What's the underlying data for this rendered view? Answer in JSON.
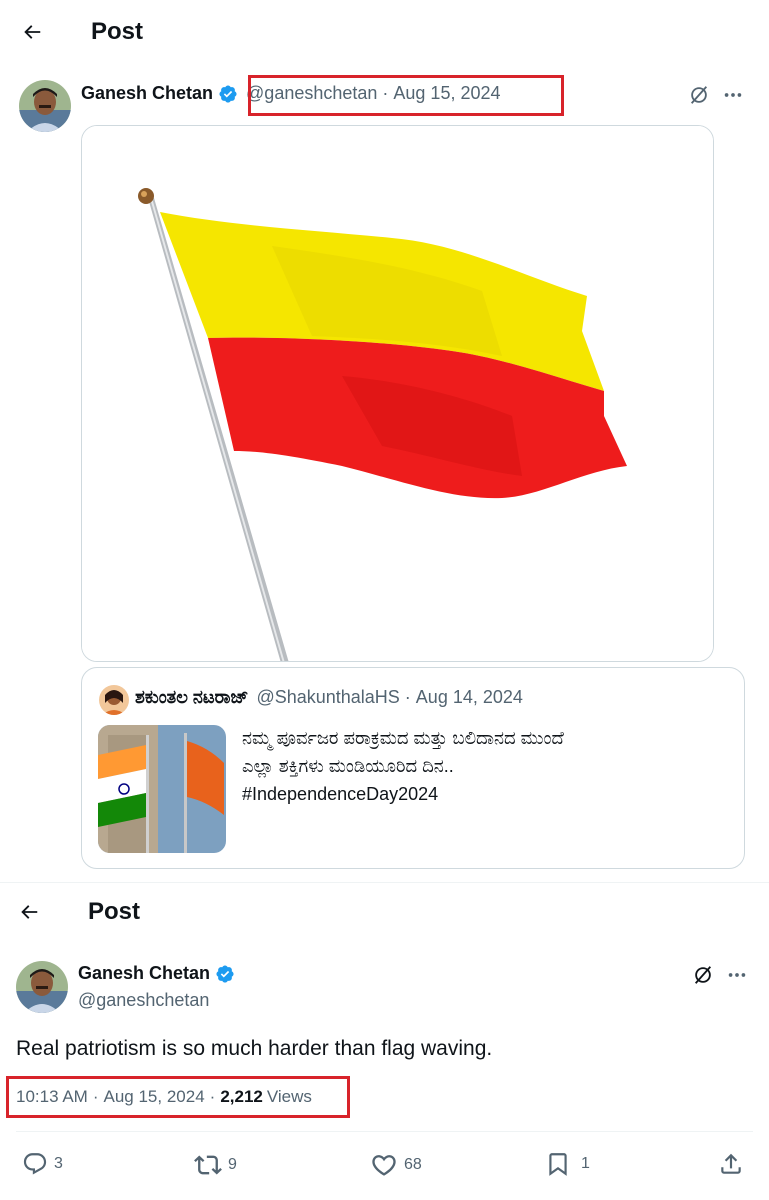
{
  "header": {
    "title": "Post"
  },
  "post1": {
    "author_name": "Ganesh Chetan",
    "handle": "@ganeshchetan",
    "date": "Aug 15, 2024",
    "separator": "·",
    "flag_colors": {
      "top": "#f5e600",
      "bottom": "#ee1c1c"
    },
    "quoted": {
      "author_name": "ಶಕುಂತಲ ನಟರಾಜ್",
      "handle": "@ShakunthalaHS",
      "date": "Aug 14, 2024",
      "text_line1": "ನಮ್ಮ ಪೂರ್ವಜರ ಪರಾಕ್ರಮದ ಮತ್ತು ಬಲಿದಾನದ ಮುಂದೆ",
      "text_line2": "ಎಲ್ಲಾ ಶಕ್ತಿಗಳು ಮಂಡಿಯೂರಿದ ದಿನ..",
      "hashtag": "#IndependenceDay2024"
    }
  },
  "post2": {
    "author_name": "Ganesh Chetan",
    "handle": "@ganeshchetan",
    "text": "Real patriotism is so much harder than flag waving.",
    "time": "10:13 AM",
    "date": "Aug 15, 2024",
    "views_count": "2,212",
    "views_label": "Views",
    "replies": "3",
    "reposts": "9",
    "likes": "68",
    "bookmarks": "1"
  },
  "colors": {
    "highlight_box": "#d8232a",
    "verified": "#1d9bf0",
    "muted_text": "#536471"
  },
  "icons": [
    "back-arrow-icon",
    "verified-badge-icon",
    "grok-icon",
    "more-icon",
    "reply-icon",
    "repost-icon",
    "like-icon",
    "bookmark-icon",
    "share-icon"
  ]
}
